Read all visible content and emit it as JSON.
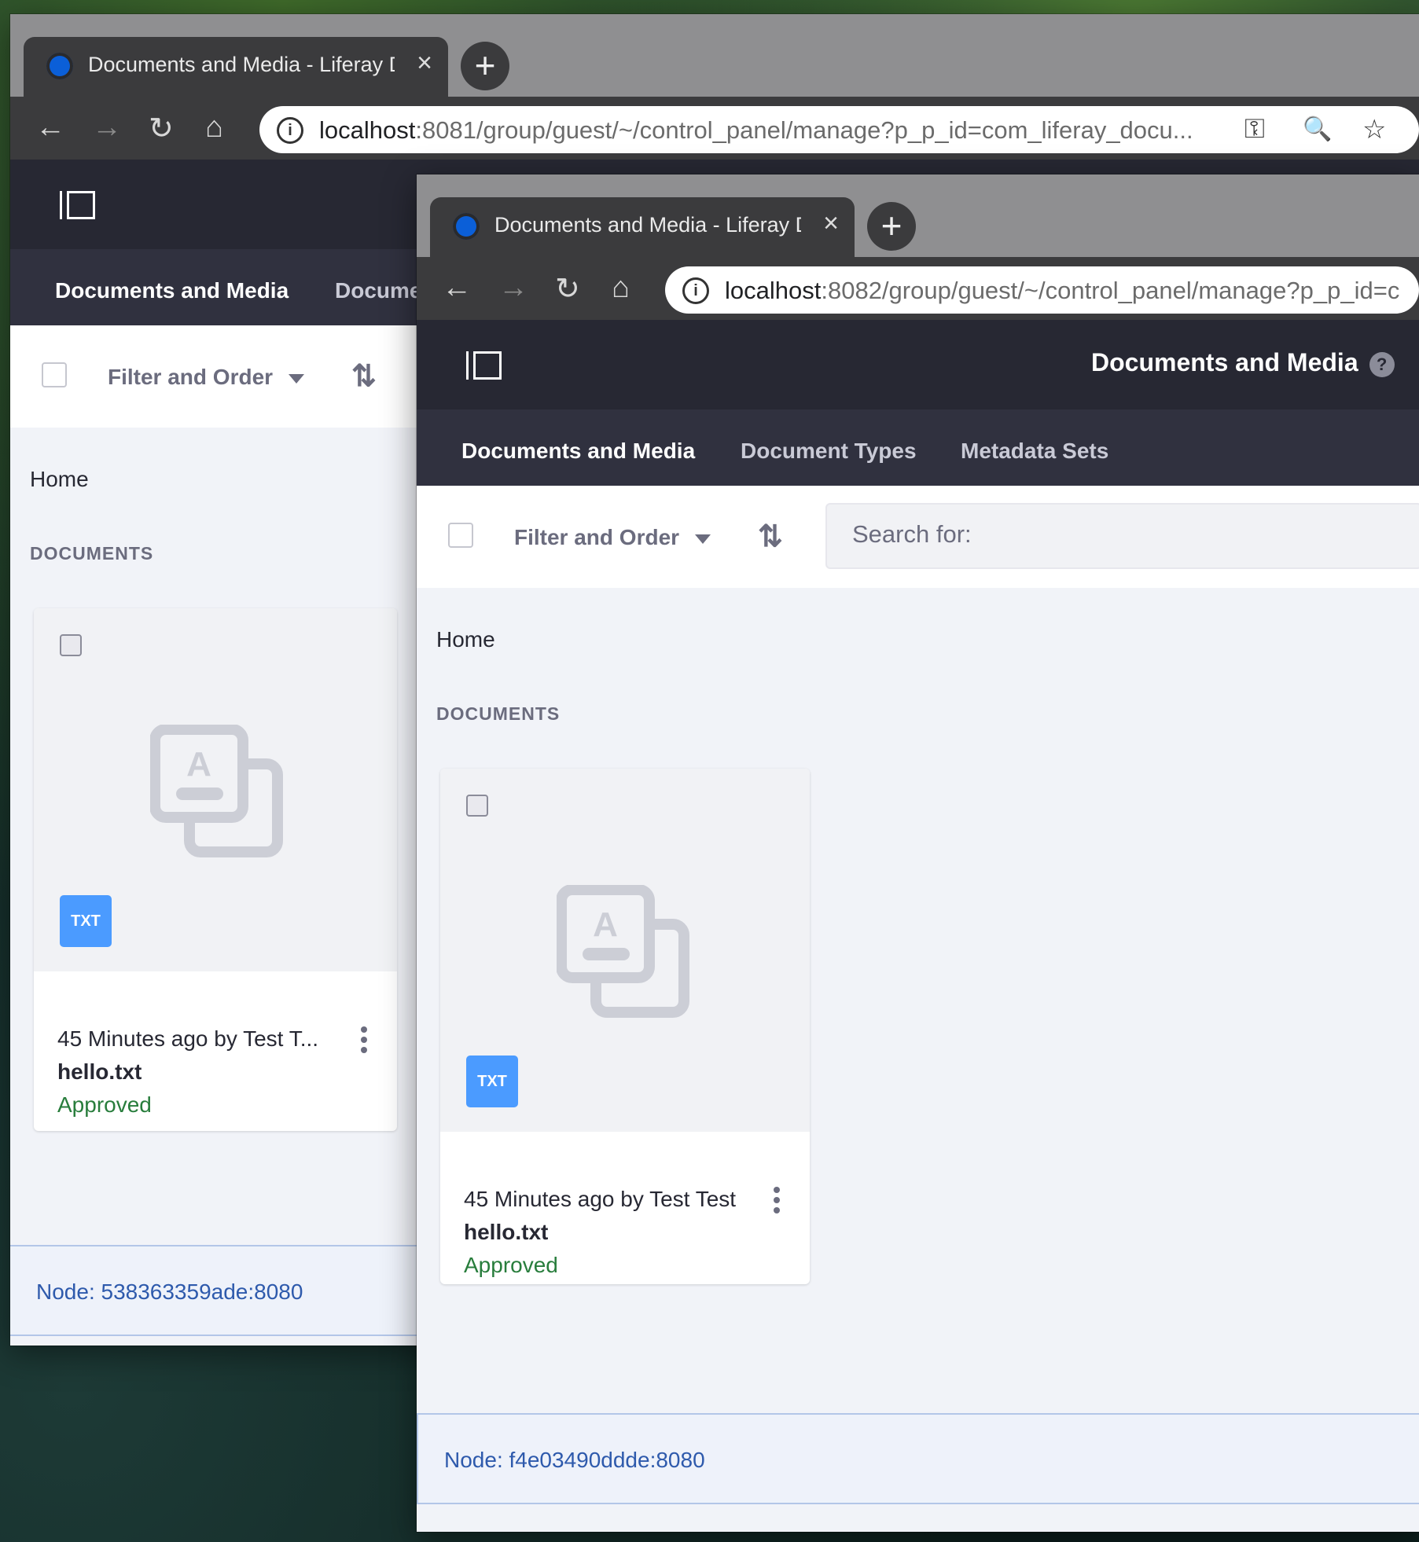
{
  "windows": [
    {
      "tab_title": "Documents and Media - Liferay DXP",
      "url_host": "localhost",
      "url_rest": ":8081/group/guest/~/control_panel/manage?p_p_id=com_liferay_docu...",
      "nav_tabs": [
        "Documents and Media",
        "Docume"
      ],
      "filter_label": "Filter and Order",
      "breadcrumb": "Home",
      "section": "DOCUMENTS",
      "card": {
        "meta": "45 Minutes ago by Test T...",
        "filename": "hello.txt",
        "status": "Approved",
        "badge": "TXT"
      },
      "node": "Node: 538363359ade:8080"
    },
    {
      "tab_title": "Documents and Media - Liferay DXP",
      "url_host": "localhost",
      "url_rest": ":8082/group/guest/~/control_panel/manage?p_p_id=c",
      "app_title": "Documents and Media",
      "nav_tabs": [
        "Documents and Media",
        "Document Types",
        "Metadata Sets"
      ],
      "filter_label": "Filter and Order",
      "search_placeholder": "Search for:",
      "breadcrumb": "Home",
      "section": "DOCUMENTS",
      "card": {
        "meta": "45 Minutes ago by Test Test",
        "filename": "hello.txt",
        "status": "Approved",
        "badge": "TXT"
      },
      "node": "Node: f4e03490ddde:8080"
    }
  ],
  "icons": {
    "close": "×",
    "newtab": "+",
    "back": "←",
    "forward": "→",
    "reload": "↻",
    "home": "⌂",
    "key": "⚿",
    "zoom": "🔍",
    "star": "☆",
    "sort": "⇅",
    "help": "?"
  },
  "colors": {
    "accent": "#5b8def",
    "approved": "#287d3c",
    "badge": "#4b9bff",
    "node_text": "#2e5aac"
  }
}
